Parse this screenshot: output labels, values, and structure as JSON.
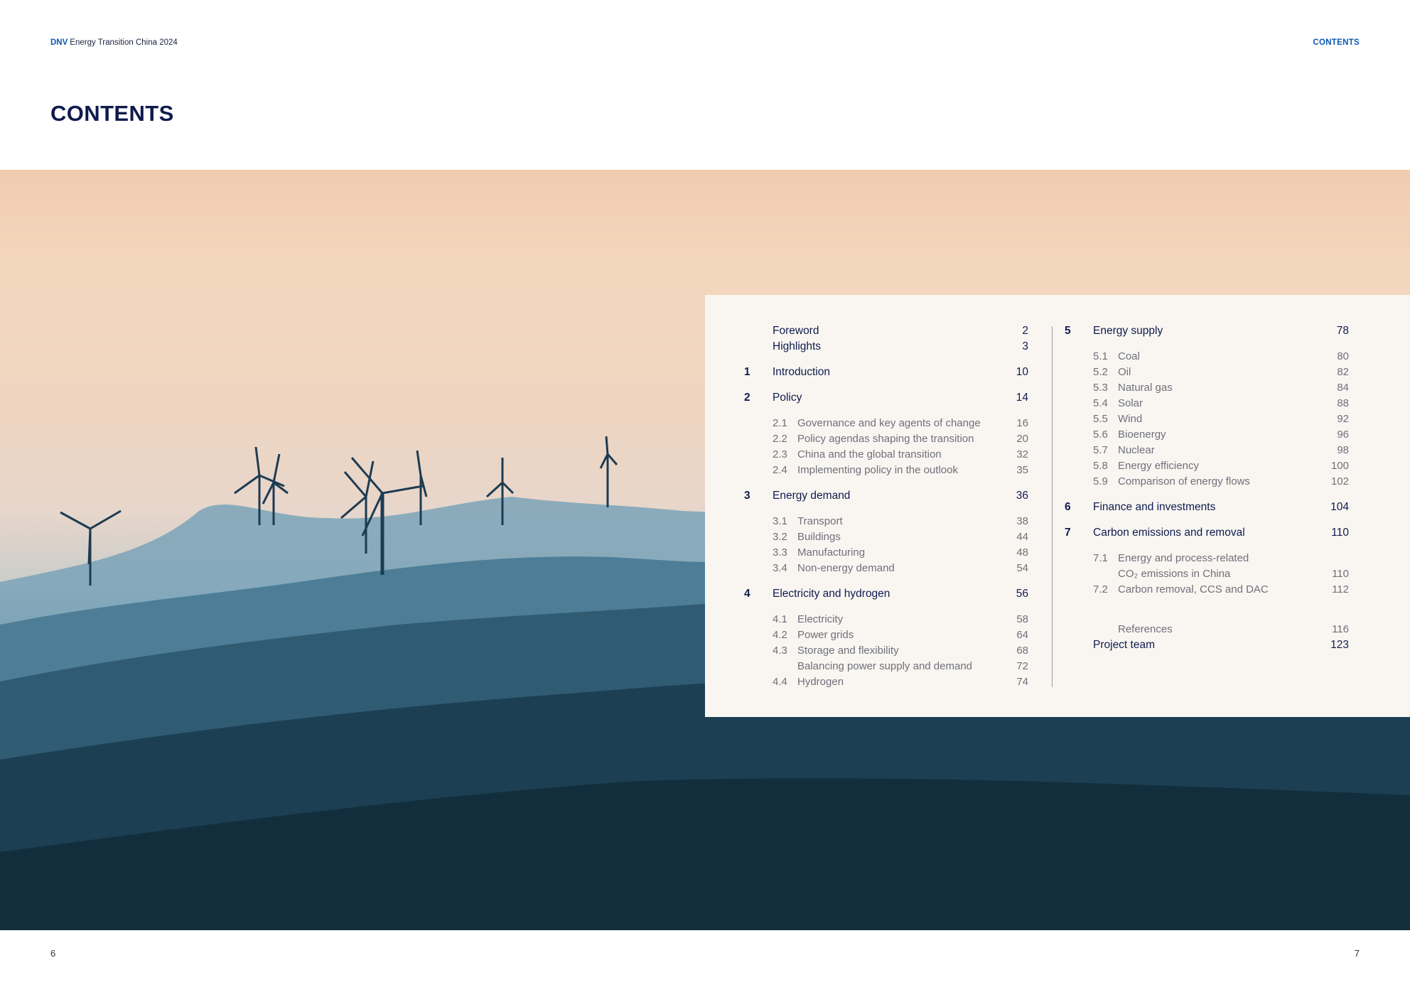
{
  "header": {
    "brand_mark": "DNV",
    "publication_title": "Energy Transition China 2024",
    "section_label": "CONTENTS"
  },
  "page_title": "CONTENTS",
  "toc": {
    "left": [
      {
        "num": "",
        "title": "Foreword",
        "page": "2"
      },
      {
        "num": "",
        "title": "Highlights",
        "page": "3"
      },
      {
        "num": "1",
        "title": "Introduction",
        "page": "10"
      },
      {
        "num": "2",
        "title": "Policy",
        "page": "14"
      },
      {
        "num": "2.1",
        "title": "Governance and key agents of change",
        "page": "16"
      },
      {
        "num": "2.2",
        "title": "Policy agendas shaping the transition",
        "page": "20"
      },
      {
        "num": "2.3",
        "title": "China and the global transition",
        "page": "32"
      },
      {
        "num": "2.4",
        "title": "Implementing policy in the outlook",
        "page": "35"
      },
      {
        "num": "3",
        "title": "Energy demand",
        "page": "36"
      },
      {
        "num": "3.1",
        "title": "Transport",
        "page": "38"
      },
      {
        "num": "3.2",
        "title": "Buildings",
        "page": "44"
      },
      {
        "num": "3.3",
        "title": "Manufacturing",
        "page": "48"
      },
      {
        "num": "3.4",
        "title": "Non-energy demand",
        "page": "54"
      },
      {
        "num": "4",
        "title": "Electricity and hydrogen",
        "page": "56"
      },
      {
        "num": "4.1",
        "title": "Electricity",
        "page": "58"
      },
      {
        "num": "4.2",
        "title": "Power grids",
        "page": "64"
      },
      {
        "num": "4.3",
        "title": "Storage and flexibility",
        "page": "68"
      },
      {
        "num": "",
        "title": "Balancing power supply and demand",
        "page": "72"
      },
      {
        "num": "4.4",
        "title": "Hydrogen",
        "page": "74"
      }
    ],
    "right": [
      {
        "num": "5",
        "title": "Energy supply",
        "page": "78"
      },
      {
        "num": "5.1",
        "title": "Coal",
        "page": "80"
      },
      {
        "num": "5.2",
        "title": "Oil",
        "page": "82"
      },
      {
        "num": "5.3",
        "title": "Natural gas",
        "page": "84"
      },
      {
        "num": "5.4",
        "title": "Solar",
        "page": "88"
      },
      {
        "num": "5.5",
        "title": "Wind",
        "page": "92"
      },
      {
        "num": "5.6",
        "title": "Bioenergy",
        "page": "96"
      },
      {
        "num": "5.7",
        "title": "Nuclear",
        "page": "98"
      },
      {
        "num": "5.8",
        "title": "Energy efficiency",
        "page": "100"
      },
      {
        "num": "5.9",
        "title": "Comparison of energy flows",
        "page": "102"
      },
      {
        "num": "6",
        "title": "Finance and investments",
        "page": "104"
      },
      {
        "num": "7",
        "title": "Carbon emissions and removal",
        "page": "110"
      },
      {
        "num": "7.1",
        "title": "Energy and process-related",
        "page": ""
      },
      {
        "num": "",
        "title": "CO₂ emissions in China",
        "page": "110"
      },
      {
        "num": "7.2",
        "title": "Carbon removal, CCS and DAC",
        "page": "112"
      },
      {
        "num": "",
        "title": "References",
        "page": "116"
      },
      {
        "num": "",
        "title": "Project team",
        "page": "123"
      }
    ]
  },
  "footer": {
    "page_left": "6",
    "page_right": "7"
  }
}
